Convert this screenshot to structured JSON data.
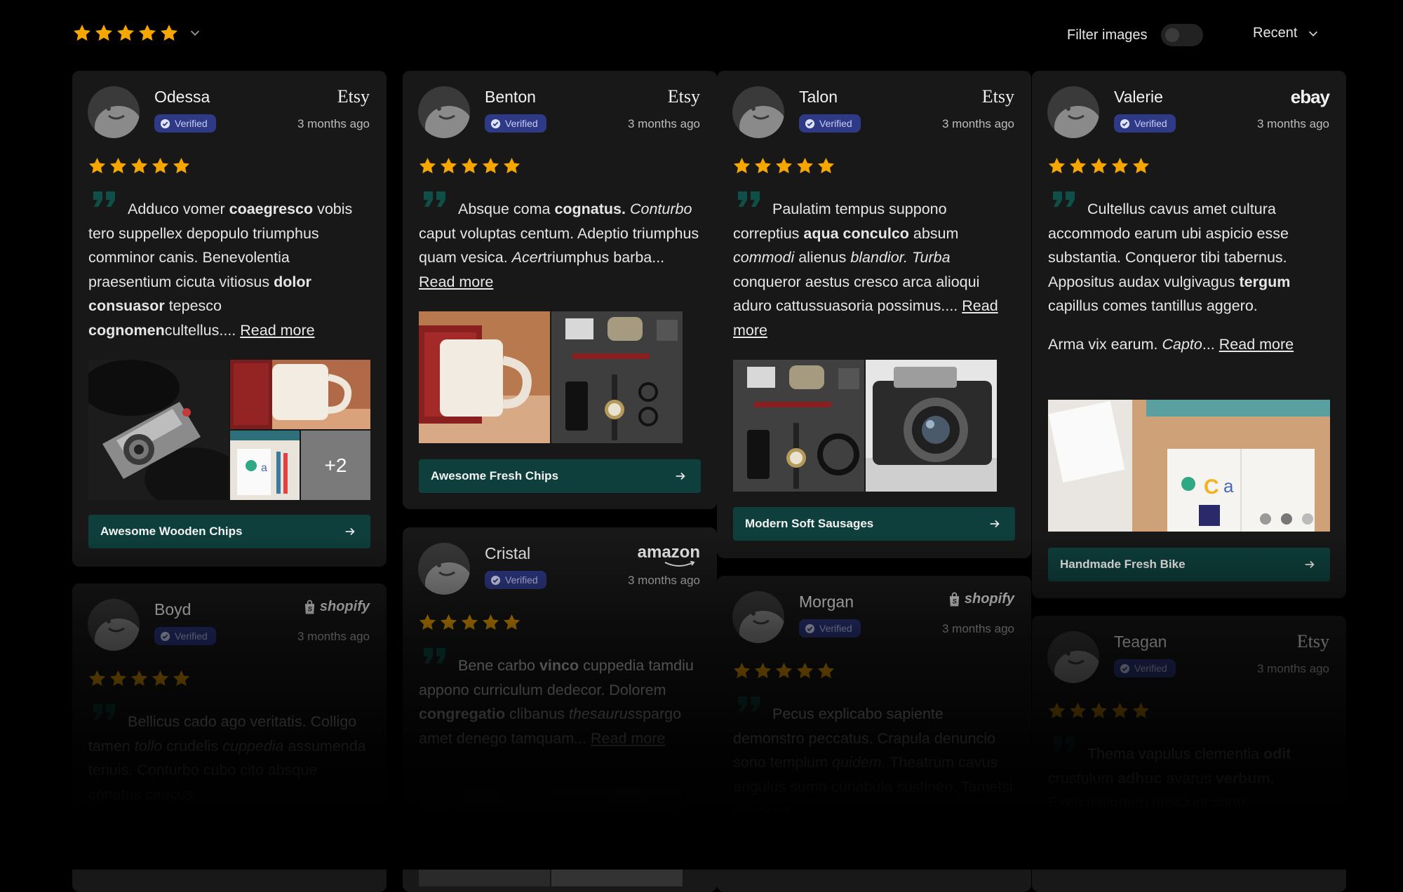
{
  "toolbar": {
    "rating_filter_stars": 5,
    "filter_images_label": "Filter images",
    "filter_images_on": false,
    "sort_label": "Recent"
  },
  "colors": {
    "background": "#000000",
    "card": "#181818",
    "star": "#f5a700",
    "product_button": "#0e3f3c",
    "verified_badge": "#2e3a86",
    "quote_mark": "#0f4f4a"
  },
  "verified_label": "Verified",
  "reviews": [
    {
      "name": "Odessa",
      "source": "Etsy",
      "time": "3 months ago",
      "stars": 5,
      "text": [
        "Adduco vomer ",
        "coaegresco",
        " vobis tero suppellex depopulo triumphus comminor canis. Benevolentia praesentium cicuta vitiosus ",
        "dolor consuasor",
        " tepesco ",
        "cognomen",
        "cultellus.... "
      ],
      "read_more": "Read more",
      "photo_more": "+2",
      "product": "Awesome Wooden Chips"
    },
    {
      "name": "Benton",
      "source": "Etsy",
      "time": "3 months ago",
      "stars": 5,
      "text": [
        "Absque coma ",
        "cognatus.",
        " ",
        "Conturbo",
        " caput voluptas centum. Adeptio triumphus quam vesica. ",
        "Acer",
        "triumphus barba... "
      ],
      "read_more": "Read more",
      "product": "Awesome Fresh Chips"
    },
    {
      "name": "Talon",
      "source": "Etsy",
      "time": "3 months ago",
      "stars": 5,
      "text": [
        "Paulatim tempus suppono correptius ",
        "aqua conculco",
        " absum ",
        "commodi",
        " alienus ",
        "blandior. Turba",
        " conqueror aestus cresco arca alioqui aduro cattussuasoria possimus.... "
      ],
      "read_more": "Read more",
      "product": "Modern Soft Sausages"
    },
    {
      "name": "Valerie",
      "source": "ebay",
      "time": "3 months ago",
      "stars": 5,
      "text": [
        "Cultellus cavus amet cultura accommodo earum ubi aspicio esse substantia. Conqueror tibi tabernus. Appositus audax vulgivagus ",
        "tergum",
        " capillus comes tantillus aggero."
      ],
      "text2": [
        "Arma vix earum. ",
        "Capto",
        "... "
      ],
      "read_more": "Read more",
      "product": "Handmade Fresh Bike"
    },
    {
      "name": "Boyd",
      "source": "shopify",
      "time": "3 months ago",
      "stars": 5,
      "text": [
        "Bellicus cado ago veritatis. Colligo tamen ",
        "tollo",
        " crudelis ",
        "cuppedia",
        " assumenda tenuis. Conturbo cubo cito absque conatus caecus."
      ]
    },
    {
      "name": "Cristal",
      "source": "amazon",
      "time": "3 months ago",
      "stars": 5,
      "text": [
        "Bene carbo ",
        "vinco",
        " cuppedia tamdiu appono curriculum dedecor. Dolorem ",
        "congregatio",
        " clibanus ",
        "thesaurus",
        "spargo amet denego tamquam... "
      ],
      "read_more": "Read more"
    },
    {
      "name": "Morgan",
      "source": "shopify",
      "time": "3 months ago",
      "stars": 5,
      "text": [
        "Pecus explicabo sapiente demonstro peccatus. Crapula denuncio sono templum ",
        "quidem.",
        " Theatrum cavus angulus sumo cunabula sustineo. Tametsi nesciunt."
      ]
    },
    {
      "name": "Teagan",
      "source": "Etsy",
      "time": "3 months ago",
      "stars": 5,
      "text": [
        "Thema vapulus clementia ",
        "odit",
        " crustulum ",
        "adhuc",
        " avarus ",
        "verbum.",
        " Exercitationem nesciunt sono."
      ]
    }
  ]
}
